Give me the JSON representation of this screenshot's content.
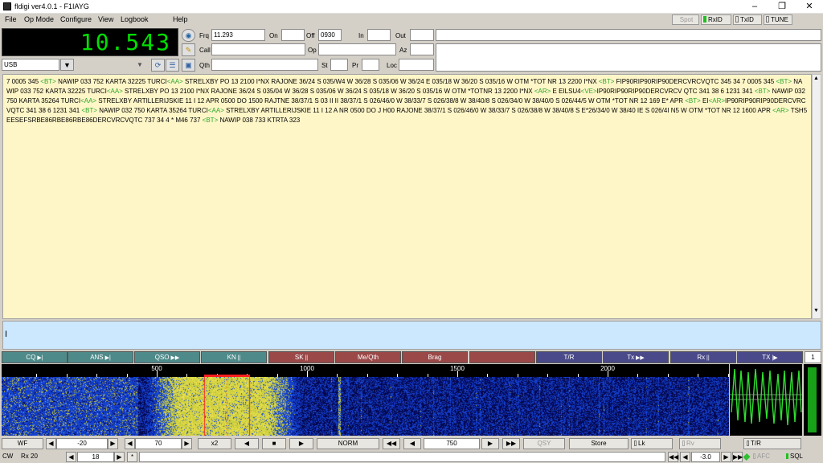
{
  "window": {
    "title": "fldigi ver4.0.1 - F1IAYG",
    "minimize": "–",
    "maximize": "❐",
    "close": "✕"
  },
  "menu": [
    "File",
    "Op Mode",
    "Configure",
    "View",
    "Logbook",
    "Help"
  ],
  "toggles": {
    "spot": "Spot",
    "rxid": "RxID",
    "txid": "TxID",
    "tune": "TUNE"
  },
  "freq_display": "10.543",
  "mode_select": "USB",
  "log": {
    "frq_label": "Frq",
    "frq_value": "11.293",
    "on_label": "On",
    "on_value": "",
    "off_label": "Off",
    "off_value": "0930",
    "in_label": "In",
    "in_value": "",
    "out_label": "Out",
    "out_value": "",
    "call_label": "Call",
    "call_value": "",
    "op_label": "Op",
    "op_value": "",
    "az_label": "Az",
    "az_value": "",
    "qth_label": "Qth",
    "qth_value": "",
    "st_label": "St",
    "st_value": "",
    "pr_label": "Pr",
    "pr_value": "",
    "loc_label": "Loc",
    "loc_value": ""
  },
  "rx_text": [
    {
      "t": " 7 0005 345 "
    },
    {
      "t": "<BT>",
      "tag": true
    },
    {
      "t": " NAWIP 033 752 KARTA 32225 TURCI"
    },
    {
      "t": "<AA>",
      "tag": true
    },
    {
      "t": " STRELXBY PO 13 2100 I*NX RAJONE 36/24 S 035/W4 W 36/28 S 035/06 W 36/24 E 035/18 W 36/20 S 035/16 W OTM *TOT NR 13 2200 I*NX "
    },
    {
      "t": "<BT>",
      "tag": true
    },
    {
      "t": " FIP90RIP90RIP90DERCVRCVQTC 345 34 7 0005 345 "
    },
    {
      "t": "<BT>",
      "tag": true
    },
    {
      "t": " NAWIP 033 752 KARTA 32225 TURCI"
    },
    {
      "t": "<AA>",
      "tag": true
    },
    {
      "t": " STRELXBY PO 13 2100 I*NX RAJONE 36/24 S 035/04 W 36/28 S 035/06 W 36/24 S 035/18 W 36/20 S 035/16 W OTM *TOTNR 13 2200 I*NX "
    },
    {
      "t": "<AR>",
      "tag": true
    },
    {
      "t": " E EILSU4"
    },
    {
      "t": "<VE>",
      "tag": true
    },
    {
      "t": "IP90RIP90RIP90DERCVRCV QTC 341 38 6 1231 341 "
    },
    {
      "t": "<BT>",
      "tag": true
    },
    {
      "t": " NAWIP 032 750 KARTA 35264 TURCI"
    },
    {
      "t": "<AA>",
      "tag": true
    },
    {
      "t": " STRELXBY ARTILLERIJSKIE 11 I 12 APR 0500 DO 1500 RAJTNE 38/37/1 S 03 II II 38/37/1 S 026/46/0 W 38/33/7 S 026/38/8 W 38/40/8 S 026/34/0 W 38/40/0 S 026/44/5 W OTM *TOT NR 12 169 E* APR "
    },
    {
      "t": "<BT>",
      "tag": true
    },
    {
      "t": " EI"
    },
    {
      "t": "<AR>",
      "tag": true
    },
    {
      "t": "IP90RIP90RIP90DERCVRCVQTC 341 38 6 1231 341 "
    },
    {
      "t": "<BT>",
      "tag": true
    },
    {
      "t": " NAWIP 032 750 KARTA 35264 TURCI"
    },
    {
      "t": "<AA>",
      "tag": true
    },
    {
      "t": " STRELXBY ARTILLERIJSKIE 11 I 12 A NR 0500 DO J H00 RAJONE 38/37/1 S 026/46/0 W 38/33/7 S 026/38/8 W 38/40/8 S E*26/34/0 W 38/40 IE S 026/4I N5 W OTM *TOT NR 12 1600 APR "
    },
    {
      "t": "<AR>",
      "tag": true
    },
    {
      "t": " TSH5EESEFSRBE86RBE86RBE86DERCVRCVQTC 737 34 4 * M46 737 "
    },
    {
      "t": "<BT>",
      "tag": true
    },
    {
      "t": " NAWIP 038 733 KTRTA 323"
    }
  ],
  "macros": [
    {
      "label": "CQ",
      "glyph": "▶|",
      "color": "#4f8a8a"
    },
    {
      "label": "ANS",
      "glyph": "▶|",
      "color": "#4f8a8a"
    },
    {
      "label": "QSO",
      "glyph": "▶▶",
      "color": "#4f8a8a"
    },
    {
      "label": "KN",
      "glyph": "||",
      "color": "#4f8a8a"
    },
    {
      "label": "SK",
      "glyph": "||",
      "color": "#9a4848"
    },
    {
      "label": "Me/Qth",
      "glyph": "",
      "color": "#9a4848"
    },
    {
      "label": "Brag",
      "glyph": "",
      "color": "#9a4848"
    },
    {
      "label": "",
      "glyph": "",
      "color": "#9a4848"
    },
    {
      "label": "T/R",
      "glyph": "",
      "color": "#4a4a8a"
    },
    {
      "label": "Tx",
      "glyph": "▶▶",
      "color": "#4a4a8a"
    },
    {
      "label": "Rx",
      "glyph": "||",
      "color": "#4a4a8a"
    },
    {
      "label": "TX",
      "glyph": "|▶",
      "color": "#4a4a8a"
    }
  ],
  "macro_page": "1",
  "ruler_ticks": [
    "500",
    "1000",
    "1500",
    "2000"
  ],
  "controls": {
    "wf": "WF",
    "ref_level": "-20",
    "ampl_span": "70",
    "zoom": "x2",
    "norm": "NORM",
    "carrier": "750",
    "qsy": "QSY",
    "store": "Store",
    "lk": "Lk",
    "rv": "Rv",
    "tr": "T/R"
  },
  "status": {
    "mode": "CW",
    "rx": "Rx 20",
    "wpm": "18",
    "star": "*",
    "offset": "-3.0",
    "afc": "AFC",
    "sql": "SQL"
  },
  "colors": {
    "rx_background": "#fff6c8",
    "tx_background": "#cce8ff",
    "tag_green": "#2aa82a",
    "freq_green": "#00e000",
    "waterfall_blue": "#0a1a80",
    "waterfall_signal": "#e8e05a",
    "cursor_red": "#ff2020"
  }
}
